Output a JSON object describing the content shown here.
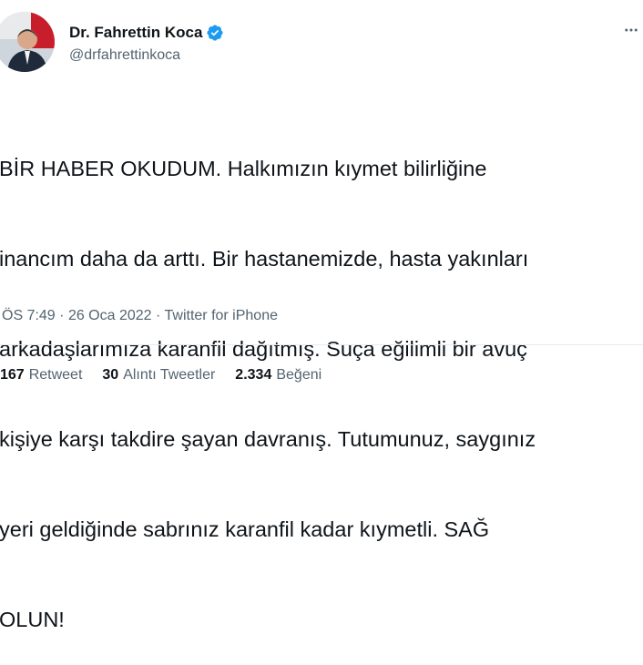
{
  "author": {
    "name": "Dr. Fahrettin Koca",
    "handle": "@drfahrettinkoca",
    "verified": true
  },
  "tweet": {
    "lines": [
      "BİR HABER OKUDUM. Halkımızın kıymet bilirliğine",
      "inancım daha da arttı. Bir hastanemizde, hasta yakınları",
      "arkadaşlarımıza karanfil dağıtmış. Suça eğilimli bir avuç",
      "kişiye karşı takdire şayan davranış. Tutumunuz, saygınız",
      "yeri geldiğinde sabrınız karanfil kadar kıymetli. SAĞ",
      "OLUN!"
    ]
  },
  "meta": {
    "time": "ÖS 7:49",
    "sep1": "·",
    "date": "26 Oca 2022",
    "sep2": "·",
    "source": "Twitter for iPhone"
  },
  "stats": {
    "retweets": {
      "count": "167",
      "label": "Retweet"
    },
    "quotes": {
      "count": "30",
      "label": "Alıntı Tweetler"
    },
    "likes": {
      "count": "2.334",
      "label": "Beğeni"
    }
  },
  "icons": {
    "verified": "verified-badge-icon",
    "more": "more-icon"
  },
  "colors": {
    "text": "#0f1419",
    "secondary": "#536471",
    "verified": "#1d9bf0"
  }
}
